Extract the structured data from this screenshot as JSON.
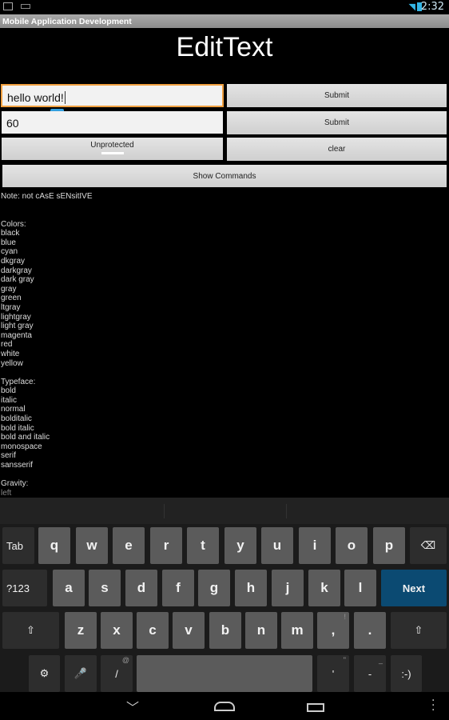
{
  "status": {
    "time": "2:32"
  },
  "app": {
    "title": "Mobile Application Development",
    "heading": "EditText"
  },
  "form": {
    "text_value": "hello world!",
    "number_value": "60",
    "submit1": "Submit",
    "submit2": "Submit",
    "toggle": "Unprotected",
    "clear": "clear",
    "show_commands": "Show Commands"
  },
  "note": "Note: not cAsE sENsitIVE",
  "colors": {
    "label": "Colors:",
    "items": [
      "black",
      "blue",
      "cyan",
      "dkgray",
      "darkgray",
      "dark gray",
      "gray",
      "green",
      "ltgray",
      "lightgray",
      "light gray",
      "magenta",
      "red",
      "white",
      "yellow"
    ]
  },
  "typeface": {
    "label": "Typeface:",
    "items": [
      "bold",
      "italic",
      "normal",
      "bolditalic",
      "bold italic",
      "bold and italic",
      "monospace",
      "serif",
      "sansserif"
    ]
  },
  "gravity": {
    "label": "Gravity:",
    "items": [
      "left"
    ]
  },
  "keyboard": {
    "rows": [
      [
        "Tab",
        "q",
        "w",
        "e",
        "r",
        "t",
        "y",
        "u",
        "i",
        "o",
        "p",
        "⌫"
      ],
      [
        "?123",
        "a",
        "s",
        "d",
        "f",
        "g",
        "h",
        "j",
        "k",
        "l",
        "Next"
      ],
      [
        "⇧",
        "z",
        "x",
        "c",
        "v",
        "b",
        "n",
        "m",
        ",",
        ".",
        "⇧"
      ],
      [
        "⚙",
        "🎤",
        "/",
        " ",
        "'",
        "-",
        ":-)"
      ]
    ],
    "hints": {
      "/": "@",
      ",": "!",
      ".": "?",
      "'": "\"",
      "-": "_"
    }
  },
  "accent": "#0b4a72"
}
